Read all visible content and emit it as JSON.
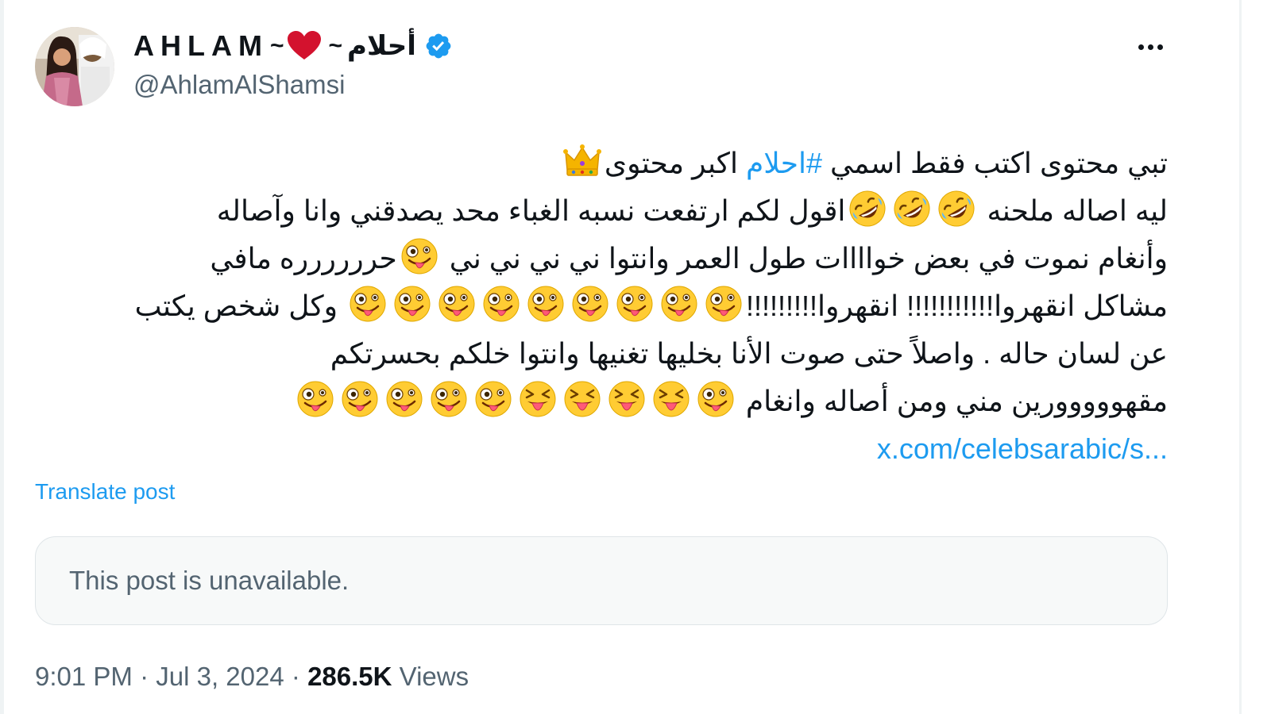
{
  "author": {
    "display_name_latin": "AHLAM",
    "name_separator_left": "~",
    "name_separator_right": "~",
    "display_name_arabic": "أحلام",
    "handle": "@AhlamAlShamsi",
    "verified": true,
    "avatar_icon": "avatar-photo"
  },
  "post": {
    "lines": {
      "l1_a": "تبي محتوى اكتب فقط اسمي ",
      "l1_hashtag": "#احلام",
      "l1_b": " اكبر محتوى",
      "l2_a": "ليه اصاله ملحنه ",
      "l2_b": "اقول لكم ارتفعت نسبه الغباء محد يصدقني وانا وآصاله",
      "l3_a": "وأنغام نموت في بعض خواااات طول العمر وانتوا ني ني ني ني ",
      "l3_b": "حرررررره مافي",
      "l4_a": "مشاكل انقهروا!!!!!!!!!!! انقهروا!!!!!!!!!",
      "l4_b": " وكل شخص يكتب",
      "l5": "عن لسان حاله . واصلاً حتى صوت الأنا بخليها تغنيها وانتوا خلكم بحسرتكم",
      "l6_a": "مقهووووورين مني ومن أصاله وانغام "
    },
    "link": "x.com/celebsarabic/s...",
    "emoji_names": [
      "crown-emoji",
      "rofl-emoji",
      "zany-face-emoji",
      "squinting-tongue-emoji"
    ]
  },
  "translate_label": "Translate post",
  "quote": {
    "unavailable_text": "This post is unavailable."
  },
  "meta": {
    "time": "9:01 PM",
    "separator": "·",
    "date": "Jul 3, 2024",
    "views_count": "286.5K",
    "views_label": "Views"
  },
  "colors": {
    "accent": "#1d9bf0",
    "secondary_text": "#536471",
    "primary_text": "#0f1419",
    "quote_bg": "#f7f9f9",
    "heart": "#d3122e"
  }
}
